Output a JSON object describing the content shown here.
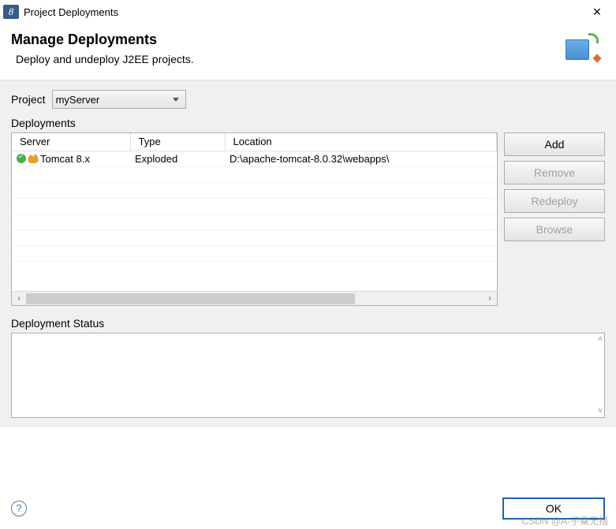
{
  "window": {
    "title": "Project Deployments"
  },
  "header": {
    "title": "Manage Deployments",
    "subtitle": "Deploy and undeploy J2EE projects."
  },
  "project": {
    "label": "Project",
    "selected": "myServer"
  },
  "deployments": {
    "label": "Deployments",
    "columns": [
      "Server",
      "Type",
      "Location"
    ],
    "rows": [
      {
        "server": "Tomcat  8.x",
        "type": "Exploded",
        "location": "D:\\apache-tomcat-8.0.32\\webapps\\"
      }
    ]
  },
  "buttons": {
    "add": "Add",
    "remove": "Remove",
    "redeploy": "Redeploy",
    "browse": "Browse"
  },
  "status": {
    "label": "Deployment Status"
  },
  "footer": {
    "ok": "OK"
  },
  "watermark": "CSDN @A-子桑无措"
}
